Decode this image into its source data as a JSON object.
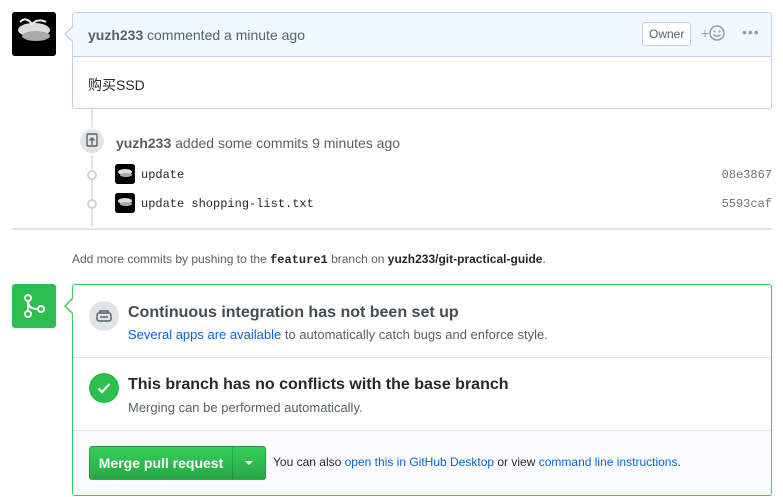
{
  "comment": {
    "author": "yuzh233",
    "action": "commented a minute ago",
    "owner_badge": "Owner",
    "react_icon": "smiley-icon",
    "react_label": "+",
    "more_label": "•••",
    "body": "购买SSD"
  },
  "push": {
    "author": "yuzh233",
    "text": "added some commits 9 minutes ago",
    "commits": [
      {
        "message": "update",
        "sha": "08e3867"
      },
      {
        "message": "update shopping-list.txt",
        "sha": "5593caf"
      }
    ]
  },
  "hint": {
    "prefix": "Add more commits by pushing to the",
    "branch": "feature1",
    "middle": "branch on",
    "repo": "yuzh233/git-practical-guide",
    "suffix": "."
  },
  "merge": {
    "ci_title": "Continuous integration has not been set up",
    "ci_link": "Several apps are available",
    "ci_desc": " to automatically catch bugs and enforce style.",
    "conflict_title": "This branch has no conflicts with the base branch",
    "conflict_desc": "Merging can be performed automatically.",
    "button_label": "Merge pull request",
    "alt_prefix": "You can also ",
    "alt_link1": "open this in GitHub Desktop",
    "alt_middle": " or view ",
    "alt_link2": "command line instructions",
    "alt_suffix": "."
  },
  "colors": {
    "accent_green": "#2cbe4e",
    "link_blue": "#0366d6",
    "comment_border": "#c0d3eb"
  }
}
